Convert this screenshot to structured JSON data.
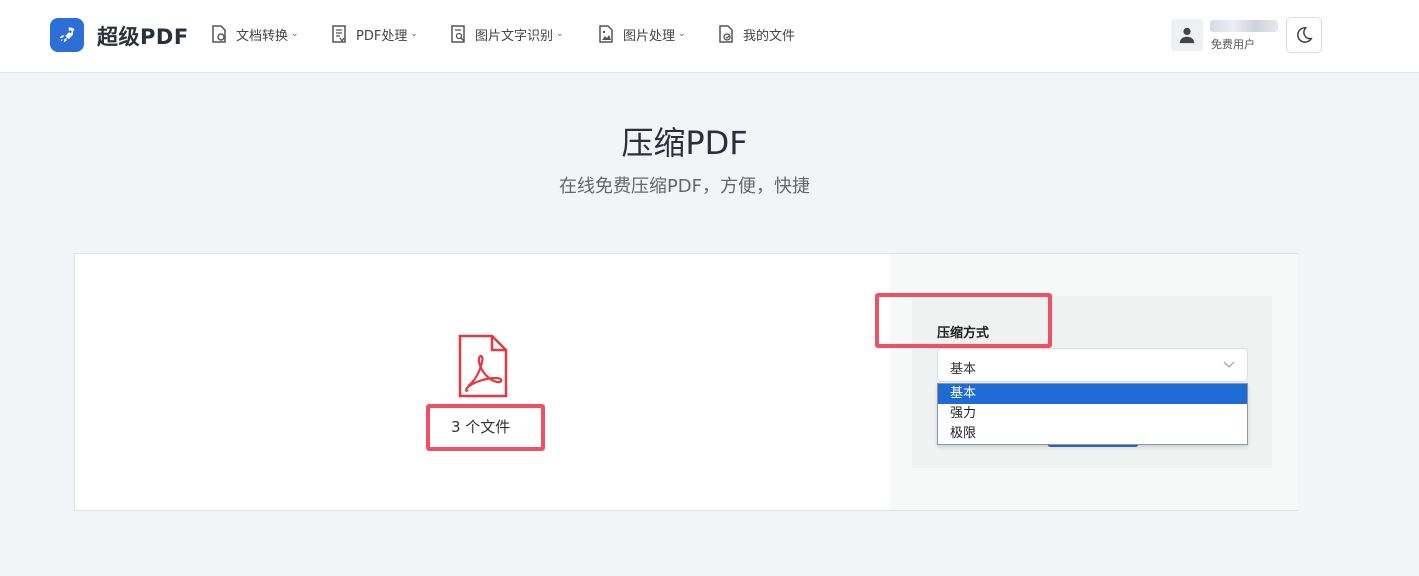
{
  "header": {
    "logo_text": "超级PDF",
    "nav": [
      {
        "label": "文档转换",
        "has_chevron": true,
        "icon": "doc-convert-icon"
      },
      {
        "label": "PDF处理",
        "has_chevron": true,
        "icon": "pdf-process-icon"
      },
      {
        "label": "图片文字识别",
        "has_chevron": true,
        "icon": "image-ocr-icon"
      },
      {
        "label": "图片处理",
        "has_chevron": true,
        "icon": "image-process-icon"
      },
      {
        "label": "我的文件",
        "has_chevron": false,
        "icon": "my-files-icon"
      }
    ],
    "user_sub": "免费用户"
  },
  "hero": {
    "title": "压缩PDF",
    "subtitle": "在线免费压缩PDF，方便，快捷"
  },
  "upload": {
    "file_count": "3 个文件"
  },
  "options": {
    "compress_label": "压缩方式",
    "selected": "基本",
    "choices": [
      "基本",
      "强力",
      "极限"
    ]
  },
  "colors": {
    "accent": "#2d6fd6",
    "highlight": "#ef5063",
    "pdf_icon": "#e5393f"
  }
}
